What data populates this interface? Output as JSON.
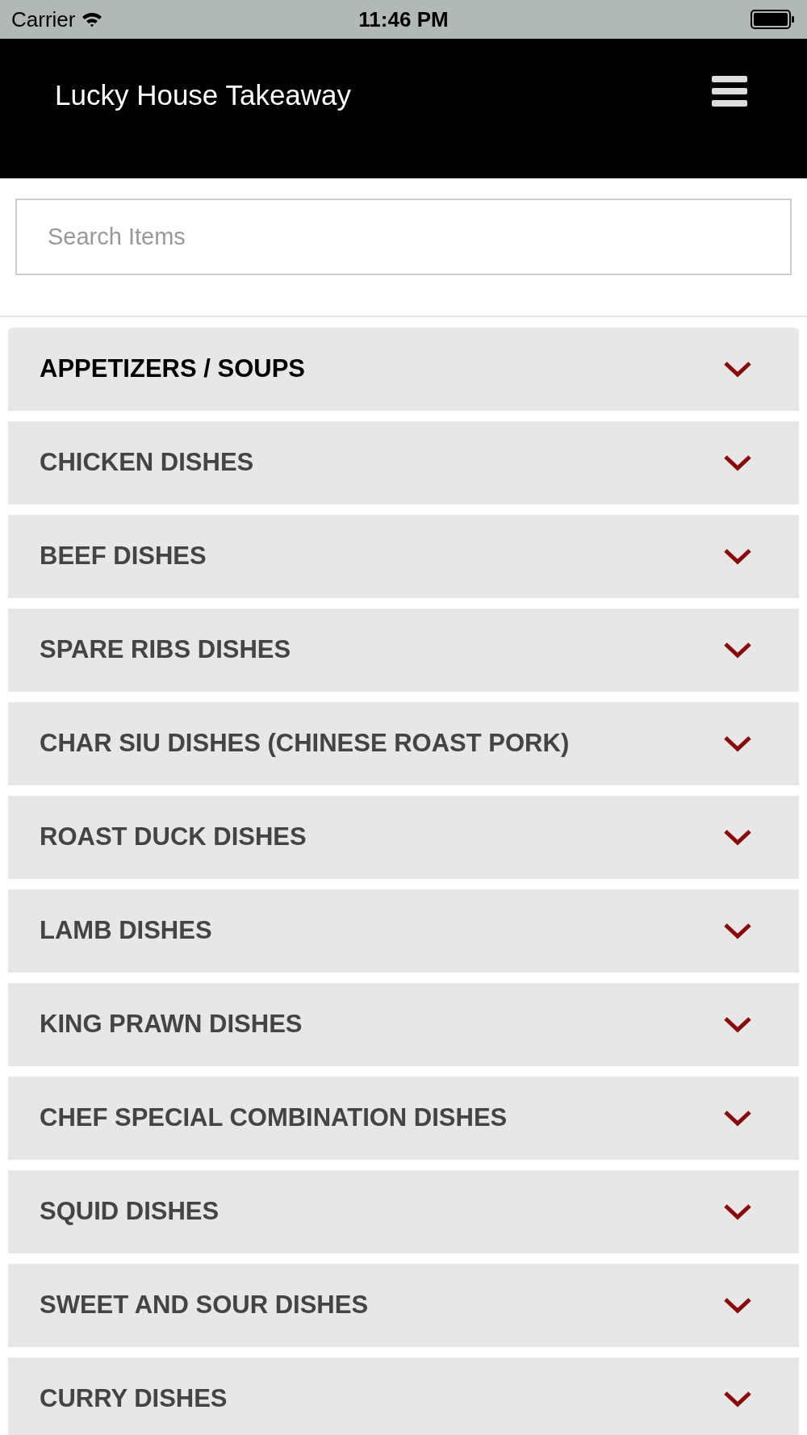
{
  "status_bar": {
    "carrier": "Carrier",
    "time": "11:46 PM"
  },
  "header": {
    "title": "Lucky House Takeaway"
  },
  "search": {
    "placeholder": "Search Items"
  },
  "categories": [
    {
      "label": "APPETIZERS / SOUPS",
      "active": true
    },
    {
      "label": "CHICKEN DISHES",
      "active": false
    },
    {
      "label": "BEEF DISHES",
      "active": false
    },
    {
      "label": "SPARE RIBS DISHES",
      "active": false
    },
    {
      "label": "CHAR SIU DISHES (CHINESE ROAST PORK)",
      "active": false
    },
    {
      "label": "ROAST DUCK DISHES",
      "active": false
    },
    {
      "label": "LAMB DISHES",
      "active": false
    },
    {
      "label": "KING PRAWN DISHES",
      "active": false
    },
    {
      "label": "CHEF SPECIAL COMBINATION DISHES",
      "active": false
    },
    {
      "label": "SQUID DISHES",
      "active": false
    },
    {
      "label": "SWEET AND SOUR DISHES",
      "active": false
    },
    {
      "label": "CURRY DISHES",
      "active": false
    }
  ]
}
